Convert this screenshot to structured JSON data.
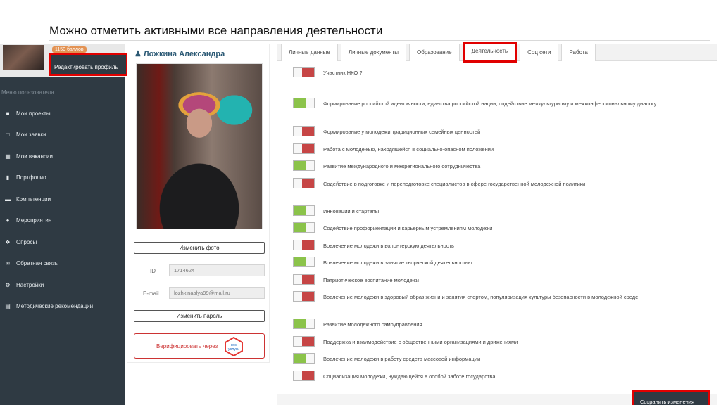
{
  "slide": {
    "title": "Можно отметить активными все направления деятельности"
  },
  "sidebar": {
    "points": "1150 баллов",
    "edit_profile": "Редактировать профиль",
    "menu_caption": "Меню пользователя",
    "items": [
      {
        "label": "Мои проекты",
        "icon": "briefcase-icon"
      },
      {
        "label": "Мои заявки",
        "icon": "bookmark-icon"
      },
      {
        "label": "Мои вакансии",
        "icon": "grid-icon"
      },
      {
        "label": "Портфолио",
        "icon": "folder-icon"
      },
      {
        "label": "Компетенции",
        "icon": "card-icon"
      },
      {
        "label": "Мероприятия",
        "icon": "people-icon"
      },
      {
        "label": "Опросы",
        "icon": "question-icon"
      },
      {
        "label": "Обратная связь",
        "icon": "envelope-icon"
      },
      {
        "label": "Настройки",
        "icon": "gear-icon"
      },
      {
        "label": "Методические рекомендации",
        "icon": "book-icon"
      }
    ]
  },
  "profile": {
    "name": "Ложкина Александра",
    "change_photo": "Изменить фото",
    "id_label": "ID",
    "id_value": "1714624",
    "email_label": "E-mail",
    "email_value": "lozhkinaalya99@mail.ru",
    "change_password": "Изменить пароль",
    "verify_text": "Верифицировать через",
    "gosuslugi_logo": "гос услуги"
  },
  "tabs": [
    {
      "label": "Личные данные",
      "active": false
    },
    {
      "label": "Личные документы",
      "active": false
    },
    {
      "label": "Образование",
      "active": false
    },
    {
      "label": "Деятельность",
      "active": true
    },
    {
      "label": "Соц сети",
      "active": false
    },
    {
      "label": "Работа",
      "active": false
    }
  ],
  "activities": [
    {
      "text": "Участник НКО ?",
      "on": false
    },
    {
      "text": "Формирование российской идентичности, единства российской нации, содействие межкультурному и межконфессиональному диалогу",
      "on": true
    },
    {
      "text": "Формирование у молодежи традиционных семейных ценностей",
      "on": false
    },
    {
      "text": "Работа с молодежью, находящейся в социально-опасном положении",
      "on": false
    },
    {
      "text": "Развитие международного и межрегионального сотрудничества",
      "on": true
    },
    {
      "text": "Содействие в подготовке и переподготовке специалистов в сфере государственной молодежной политики",
      "on": false
    },
    {
      "text": "Инновации и стартапы",
      "on": true
    },
    {
      "text": "Содействие профориентации и карьерным устремлениям молодежи",
      "on": true
    },
    {
      "text": "Вовлечение молодежи в волонтерскую деятельность",
      "on": false
    },
    {
      "text": "Вовлечение молодежи в занятие творческой деятельностью",
      "on": true
    },
    {
      "text": "Патриотическое воспитание молодежи",
      "on": false
    },
    {
      "text": "Вовлечение молодежи в здоровый образ жизни и занятия спортом, популяризация культуры безопасности в молодежной среде",
      "on": false
    },
    {
      "text": "Развитие молодежного самоуправления",
      "on": true
    },
    {
      "text": "Поддержка и взаимодействие с общественными организациями и движениями",
      "on": false
    },
    {
      "text": "Вовлечение молодежи в работу средств массовой информации",
      "on": true
    },
    {
      "text": "Социализация молодежи, нуждающейся в особой заботе государства",
      "on": false
    }
  ],
  "save_button": "Сохранить изменения",
  "colors": {
    "toggle_on": "#8bc34a",
    "toggle_off": "#c64545",
    "highlight": "#e10000",
    "sidebar": "#2f3a43"
  }
}
